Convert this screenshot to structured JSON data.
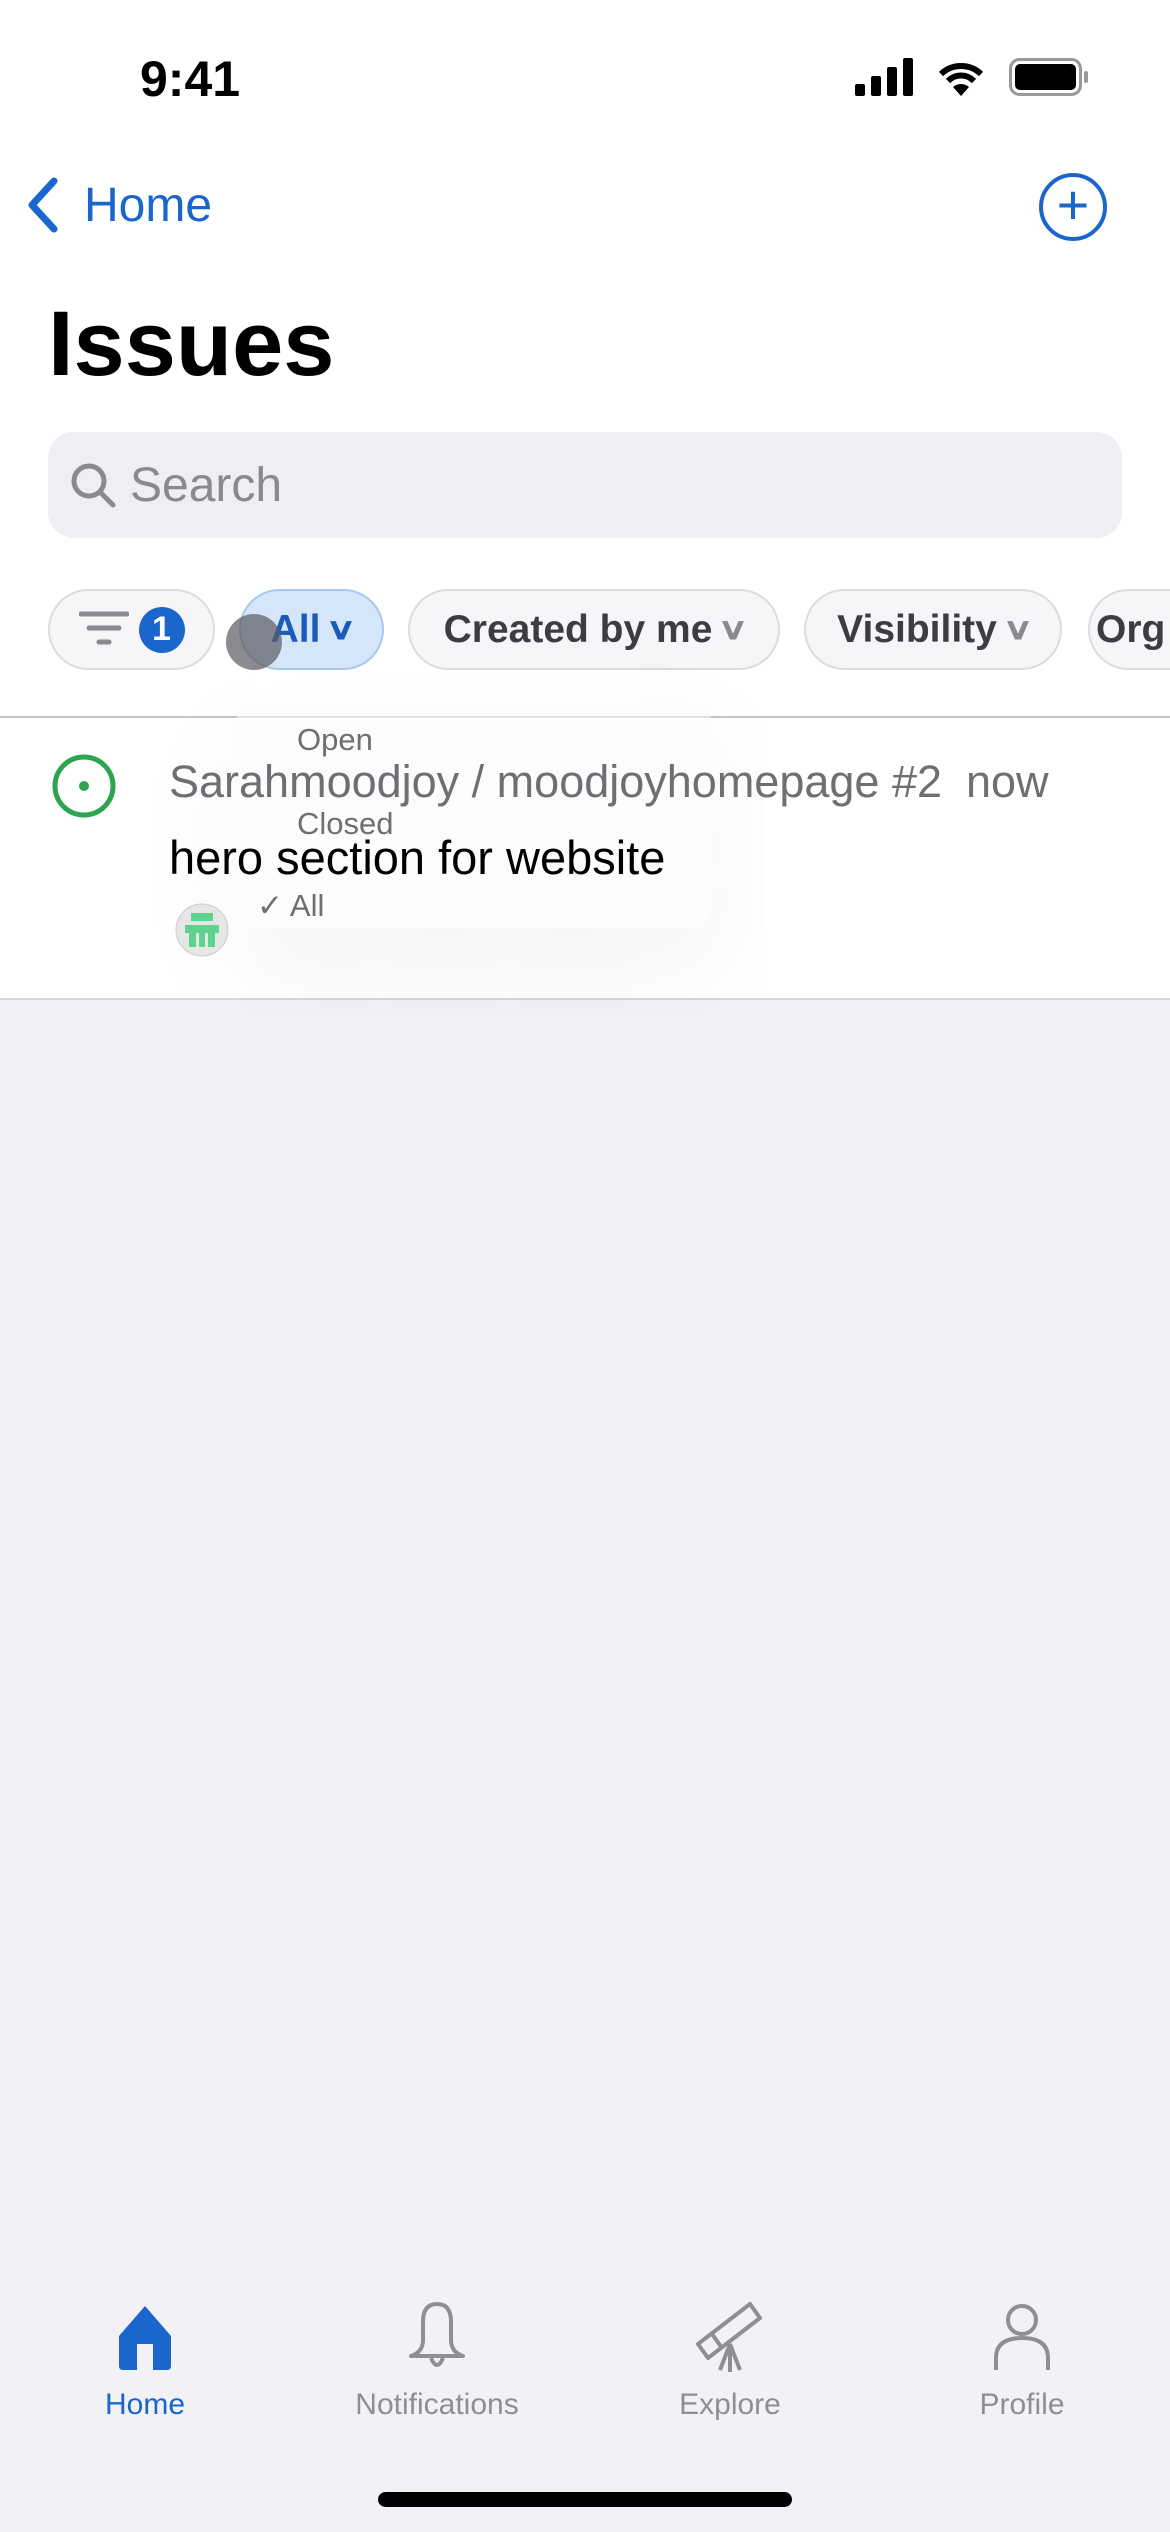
{
  "status_bar": {
    "time": "9:41"
  },
  "nav": {
    "back_label": "Home",
    "add_icon": "plus-circle-icon"
  },
  "page": {
    "title": "Issues"
  },
  "search": {
    "placeholder": "Search",
    "value": ""
  },
  "filters": {
    "filter_count": "1",
    "chips": [
      {
        "label": "All",
        "active": true
      },
      {
        "label": "Created by me"
      },
      {
        "label": "Visibility"
      },
      {
        "label": "Org"
      }
    ]
  },
  "issues": [
    {
      "repo": "Sarahmoodjoy / moodjoyhomepage #2",
      "time": "now",
      "title": "hero section for website",
      "status": "open",
      "status_color": "#2da44e"
    }
  ],
  "state_menu": {
    "items": [
      "Open",
      "Closed",
      "All"
    ],
    "selected": "All",
    "check": "✓"
  },
  "tabbar": {
    "items": [
      {
        "label": "Home",
        "icon": "home-icon",
        "active": true
      },
      {
        "label": "Notifications",
        "icon": "bell-icon"
      },
      {
        "label": "Explore",
        "icon": "telescope-icon"
      },
      {
        "label": "Profile",
        "icon": "person-icon"
      }
    ]
  },
  "colors": {
    "accent": "#1a66cc",
    "background": "#f1f1f6"
  }
}
